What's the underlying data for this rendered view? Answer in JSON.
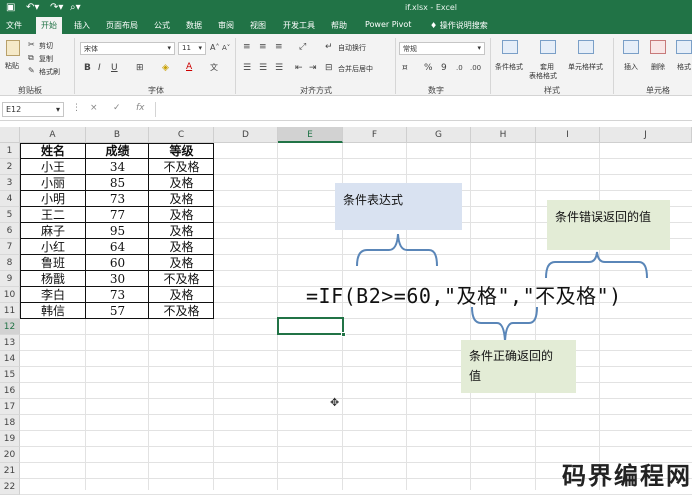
{
  "window": {
    "title": "if.xlsx  -  Excel"
  },
  "quick_access": {
    "save_icon": "save-icon",
    "undo_icon": "undo-icon",
    "redo_icon": "redo-icon",
    "preview_icon": "print-preview-icon"
  },
  "menu": {
    "items": [
      "文件",
      "开始",
      "插入",
      "页面布局",
      "公式",
      "数据",
      "审阅",
      "视图",
      "开发工具",
      "帮助",
      "Power Pivot"
    ],
    "active_index": 1,
    "search_placeholder": "操作说明搜索"
  },
  "ribbon": {
    "clipboard": {
      "paste": "粘贴",
      "cut": "剪切",
      "copy": "复制",
      "format_painter": "格式刷",
      "label": "剪贴板"
    },
    "font": {
      "name": "宋体",
      "size": "11",
      "label": "字体",
      "bold": "B",
      "italic": "I",
      "underline": "U",
      "font_color_letter": "A"
    },
    "alignment": {
      "wrap": "自动换行",
      "merge": "合并后居中",
      "label": "对齐方式"
    },
    "number": {
      "format": "常规",
      "percent": "%",
      "comma": "9",
      "label": "数字"
    },
    "styles": {
      "conditional": "条件格式",
      "table_line1": "套用",
      "table_line2": "表格格式",
      "cell_styles": "单元格样式",
      "label": "样式"
    },
    "cells": {
      "insert": "插入",
      "delete": "删除",
      "format": "格式",
      "label": "单元格"
    }
  },
  "formula_bar": {
    "name_box": "E12",
    "cancel": "×",
    "confirm": "✓",
    "fx": "fx",
    "value": ""
  },
  "sheet": {
    "columns": [
      "A",
      "B",
      "C",
      "D",
      "E",
      "F",
      "G",
      "H",
      "I",
      "J"
    ],
    "selected_column": "E",
    "rows": [
      "1",
      "2",
      "3",
      "4",
      "5",
      "6",
      "7",
      "8",
      "9",
      "10",
      "11",
      "12",
      "13",
      "14",
      "15",
      "16",
      "17",
      "18",
      "19",
      "20",
      "21",
      "22"
    ],
    "selected_row": "12",
    "table": [
      [
        "姓名",
        "成绩",
        "等级"
      ],
      [
        "小王",
        "34",
        "不及格"
      ],
      [
        "小丽",
        "85",
        "及格"
      ],
      [
        "小明",
        "73",
        "及格"
      ],
      [
        "王二",
        "77",
        "及格"
      ],
      [
        "麻子",
        "95",
        "及格"
      ],
      [
        "小红",
        "64",
        "及格"
      ],
      [
        "鲁班",
        "60",
        "及格"
      ],
      [
        "杨戬",
        "30",
        "不及格"
      ],
      [
        "李白",
        "73",
        "及格"
      ],
      [
        "韩信",
        "57",
        "不及格"
      ]
    ]
  },
  "annotations": {
    "formula": "=IF(B2>=60,\"及格\",\"不及格\")",
    "condition_label": "条件表达式",
    "false_label": "条件错误返回的值",
    "true_label_line1": "条件正确返回的",
    "true_label_line2": "值"
  },
  "watermark": "码界编程网",
  "colors": {
    "excel_green": "#217346",
    "brace": "#5a86b8",
    "note_blue": "#d9e2f1",
    "note_green": "#e3ecd6"
  }
}
